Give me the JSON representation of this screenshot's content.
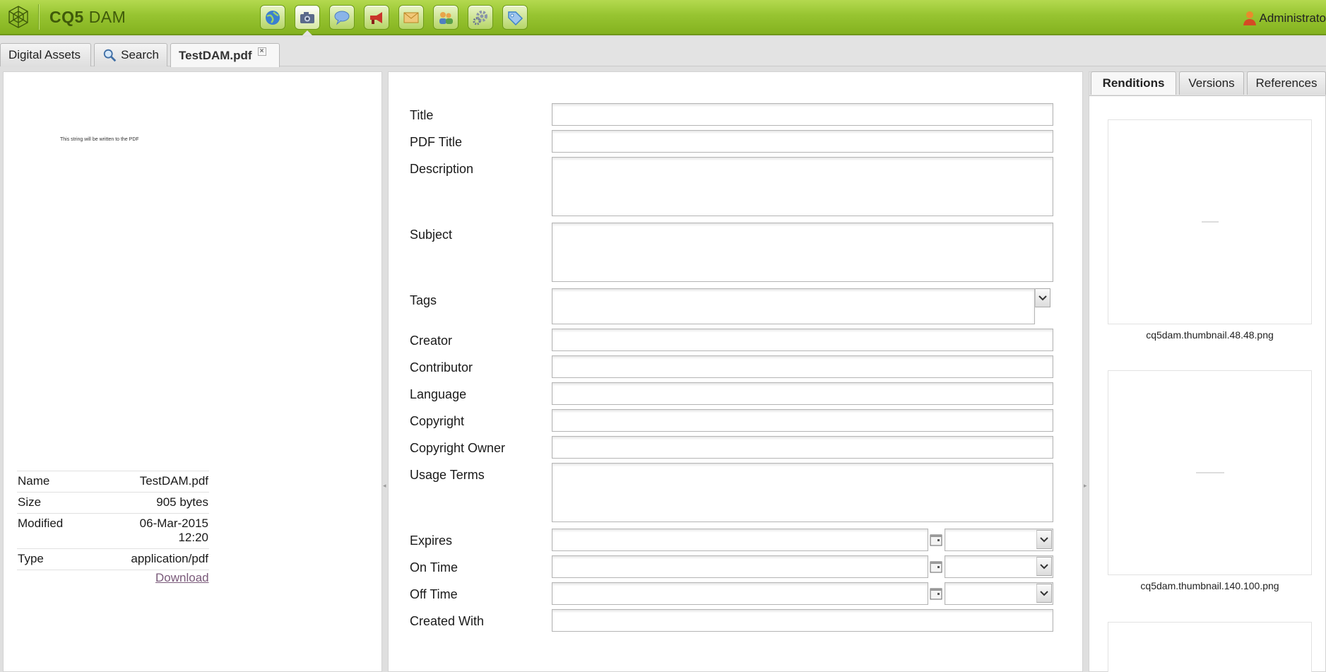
{
  "header": {
    "logo_bold": "CQ5",
    "logo_light": "DAM",
    "user_label": "Administrato",
    "apps": [
      {
        "name": "websites-icon",
        "color": "#3a7fd0"
      },
      {
        "name": "dam-camera-icon",
        "color": "#5a6a8a"
      },
      {
        "name": "community-bubble-icon",
        "color": "#8ab4e8"
      },
      {
        "name": "campaigns-megaphone-icon",
        "color": "#c9352b"
      },
      {
        "name": "inbox-envelope-icon",
        "color": "#d9a443"
      },
      {
        "name": "users-icon",
        "color": "#4f7fc0"
      },
      {
        "name": "tools-gear-icon",
        "color": "#8a95a8"
      },
      {
        "name": "tagging-icon",
        "color": "#3d82c8"
      }
    ]
  },
  "tabs": [
    {
      "label": "Digital Assets"
    },
    {
      "label": "Search"
    },
    {
      "label": "TestDAM.pdf"
    }
  ],
  "preview": {
    "pdf_text": "This string will be written to the PDF"
  },
  "metadata": {
    "rows": [
      {
        "key": "Name",
        "value": "TestDAM.pdf"
      },
      {
        "key": "Size",
        "value": "905 bytes"
      },
      {
        "key": "Modified",
        "value": "06-Mar-2015",
        "value2": "12:20"
      },
      {
        "key": "Type",
        "value": "application/pdf"
      }
    ],
    "download_label": "Download"
  },
  "form": {
    "title": "Title",
    "pdf_title": "PDF Title",
    "description": "Description",
    "subject": "Subject",
    "tags": "Tags",
    "creator": "Creator",
    "contributor": "Contributor",
    "language": "Language",
    "copyright": "Copyright",
    "copyright_owner": "Copyright Owner",
    "usage_terms": "Usage Terms",
    "expires": "Expires",
    "on_time": "On Time",
    "off_time": "Off Time",
    "created_with": "Created With"
  },
  "right_tabs": [
    {
      "label": "Renditions"
    },
    {
      "label": "Versions"
    },
    {
      "label": "References"
    }
  ],
  "renditions": [
    {
      "label": "cq5dam.thumbnail.48.48.png"
    },
    {
      "label": "cq5dam.thumbnail.140.100.png"
    }
  ]
}
